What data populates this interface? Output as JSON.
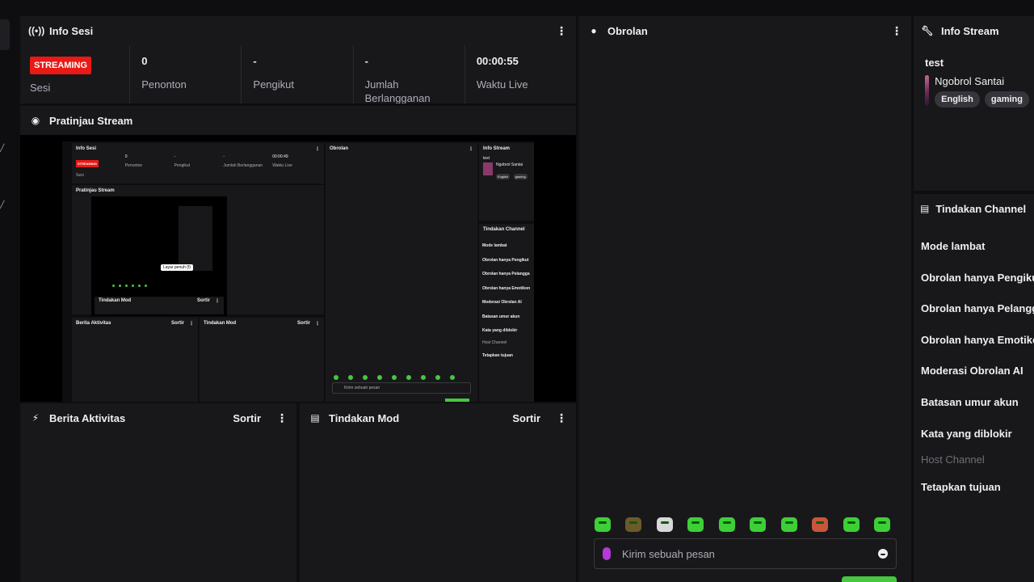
{
  "session": {
    "title": "Info Sesi",
    "status_badge": "STREAMING",
    "session_label": "Sesi",
    "stats": [
      {
        "value": "0",
        "label": "Penonton"
      },
      {
        "value": "-",
        "label": "Pengikut"
      },
      {
        "value": "-",
        "label": "Jumlah Berlangganan"
      },
      {
        "value": "00:00:55",
        "label": "Waktu Live"
      }
    ]
  },
  "preview": {
    "title": "Pratinjau Stream",
    "mini": {
      "info_title": "Info Sesi",
      "badge": "STREAMING",
      "session_label": "Sesi",
      "stats": [
        {
          "value": "0",
          "label": "Penonton"
        },
        {
          "value": "-",
          "label": "Pengikut"
        },
        {
          "value": "-",
          "label": "Jumlah Berlangganan"
        },
        {
          "value": "00:00:49",
          "label": "Waktu Live"
        }
      ],
      "preview_title": "Pratinjau Stream",
      "tooltip": "Layar penuh (f)",
      "inner_mod_title": "Tindakan Mod",
      "inner_sort": "Sortir",
      "activity_title": "Berita Aktivitas",
      "mod_title": "Tindakan Mod",
      "sort": "Sortir",
      "chat_title": "Obrolan",
      "chat_placeholder": "Kirim sebuah pesan",
      "stream_title": "Info Stream",
      "stream_name": "test",
      "category": "Ngobrol Santai",
      "tags": [
        "English",
        "gaming"
      ],
      "actions_title": "Tindakan Channel",
      "actions": [
        "Mode lambat",
        "Obrolan hanya Pengikut",
        "Obrolan hanya Pelangga",
        "Obrolan hanya Emotikon",
        "Moderasi Obrolan AI",
        "Batasan umur akun",
        "Kata yang diblokir",
        "Host Channel",
        "Tetapkan tujuan"
      ]
    }
  },
  "activity": {
    "title": "Berita Aktivitas",
    "sort_label": "Sortir"
  },
  "mod_actions": {
    "title": "Tindakan Mod",
    "sort_label": "Sortir"
  },
  "chat": {
    "title": "Obrolan",
    "placeholder": "Kirim sebuah pesan",
    "emote_count": 10
  },
  "stream_info": {
    "title": "Info Stream",
    "stream_title": "test",
    "category": "Ngobrol Santai",
    "tags": [
      "English",
      "gaming"
    ]
  },
  "channel_actions": {
    "title": "Tindakan Channel",
    "items": [
      {
        "label": "Mode lambat",
        "enabled": true
      },
      {
        "label": "Obrolan hanya Pengikut",
        "enabled": true
      },
      {
        "label": "Obrolan hanya Pelanggan",
        "enabled": true
      },
      {
        "label": "Obrolan hanya Emotikon",
        "enabled": true
      },
      {
        "label": "Moderasi Obrolan AI",
        "enabled": true
      },
      {
        "label": "Batasan umur akun",
        "enabled": true
      },
      {
        "label": "Kata yang diblokir",
        "enabled": true
      },
      {
        "label": "Host Channel",
        "enabled": false
      },
      {
        "label": "Tetapkan tujuan",
        "enabled": true
      }
    ]
  },
  "colors": {
    "accent": "#45c83f",
    "live": "#e91916",
    "panel": "#18181b",
    "background": "#0e0e10"
  },
  "icons": {
    "session": "broadcast-icon",
    "preview": "camera-icon",
    "activity": "lightning-icon",
    "mod": "document-icon",
    "chat": "chat-bubble-icon",
    "stream_info": "wrench-icon",
    "channel_actions": "document-icon",
    "menu": "kebab-menu-icon"
  }
}
